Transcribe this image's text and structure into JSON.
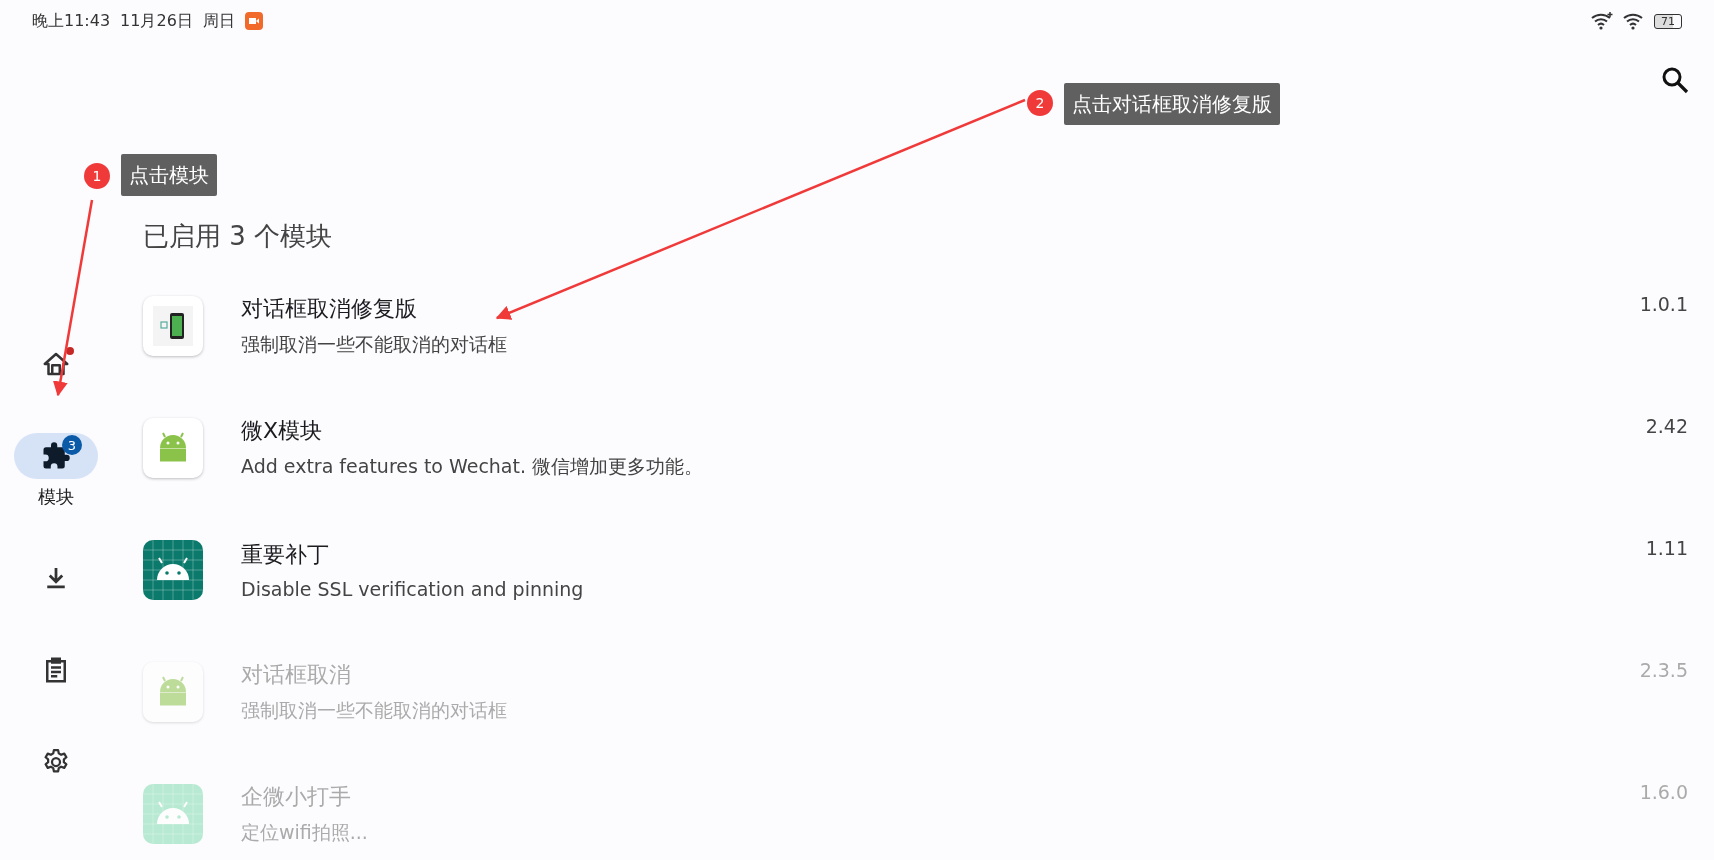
{
  "status_bar": {
    "time": "晚上11:43",
    "date": "11月26日",
    "weekday": "周日",
    "battery": "71"
  },
  "nav": [
    {
      "kind": "home",
      "selected": false,
      "alert": true
    },
    {
      "kind": "modules",
      "selected": true,
      "alert": false,
      "badge": "3",
      "label": "模块"
    },
    {
      "kind": "download",
      "selected": false,
      "alert": false
    },
    {
      "kind": "logs",
      "selected": false,
      "alert": false
    },
    {
      "kind": "settings",
      "selected": false,
      "alert": false
    }
  ],
  "page": {
    "subtitle": "已启用 3 个模块"
  },
  "modules": [
    {
      "kind": "phone",
      "name": "对话框取消修复版",
      "description": "强制取消一些不能取消的对话框",
      "version": "1.0.1",
      "enabled": true
    },
    {
      "kind": "plain",
      "name": "微X模块",
      "description": "Add extra features to Wechat. 微信增加更多功能。",
      "version": "2.42",
      "enabled": true
    },
    {
      "kind": "grid",
      "name": "重要补丁",
      "description": "Disable SSL verification and pinning",
      "version": "1.11",
      "enabled": true
    },
    {
      "kind": "plain",
      "name": "对话框取消",
      "description": "强制取消一些不能取消的对话框",
      "version": "2.3.5",
      "enabled": false
    },
    {
      "kind": "mint",
      "name": "企微小打手",
      "description": "定位wifi拍照...",
      "version": "1.6.0",
      "enabled": false
    }
  ],
  "annotations": [
    {
      "number": "1",
      "text": "点击模块"
    },
    {
      "number": "2",
      "text": "点击对话框取消修复版"
    }
  ]
}
